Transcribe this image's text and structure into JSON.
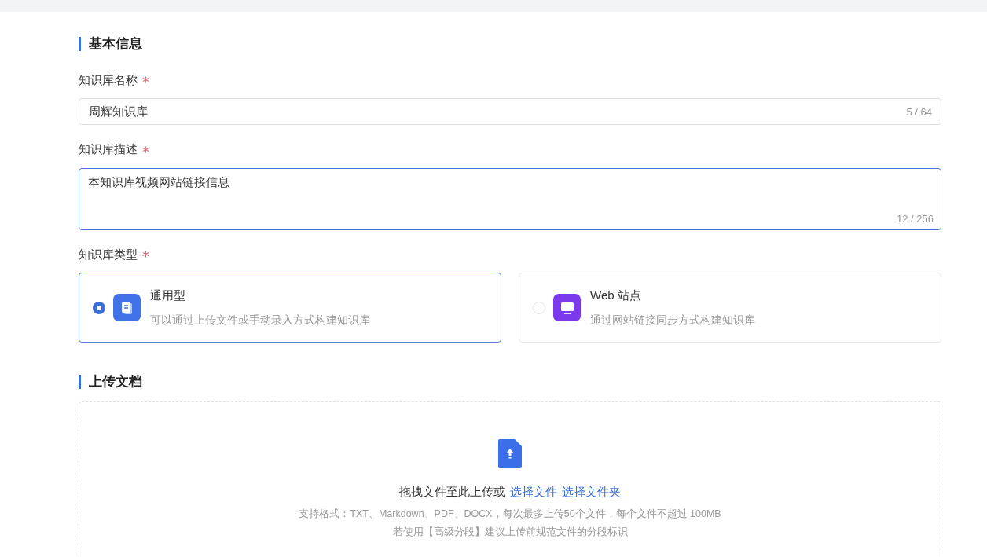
{
  "basic_info": {
    "title": "基本信息",
    "name_field": {
      "label": "知识库名称",
      "required": true,
      "value": "周辉知识库",
      "counter": "5 / 64",
      "focused": false
    },
    "description_field": {
      "label": "知识库描述",
      "required": true,
      "value": "本知识库视频网站链接信息",
      "counter": "12 / 256",
      "focused": true
    },
    "type_field": {
      "label": "知识库类型",
      "required": true,
      "options": [
        {
          "kind": "document",
          "title": "通用型",
          "description": "可以通过上传文件或手动录入方式构建知识库",
          "selected": true
        },
        {
          "kind": "website",
          "title": "Web 站点",
          "description": "通过网站链接同步方式构建知识库",
          "selected": false
        }
      ]
    }
  },
  "upload": {
    "title": "上传文档",
    "prompt": "拖拽文件至此上传或",
    "links": [
      "选择文件",
      "选择文件夹"
    ],
    "formats": "支持格式：TXT、Markdown、PDF、DOCX，每次最多上传50个文件，每个文件不超过 100MB",
    "hint": "若使用【高级分段】建议上传前规范文件的分段标识"
  }
}
